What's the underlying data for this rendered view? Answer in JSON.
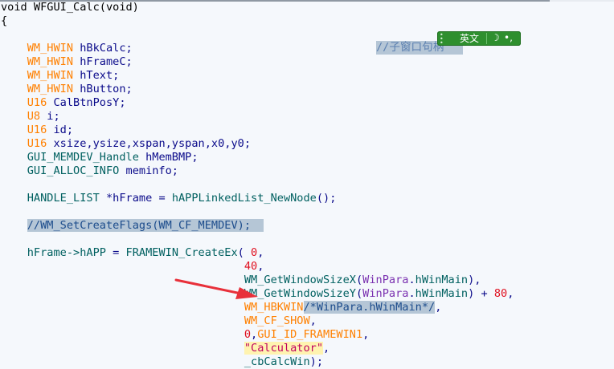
{
  "editor": {
    "lines": [
      [
        {
          "text": "void WFGUI_Calc(void)",
          "cls": "n"
        }
      ],
      [
        {
          "text": "{",
          "cls": "n"
        }
      ],
      [],
      [
        {
          "text": "    "
        },
        {
          "text": "WM_HWIN",
          "cls": "t"
        },
        {
          "text": " hBkCalc;",
          "cls": "v"
        }
      ],
      [
        {
          "text": "    "
        },
        {
          "text": "WM_HWIN",
          "cls": "t"
        },
        {
          "text": " hFrameC;",
          "cls": "v"
        }
      ],
      [
        {
          "text": "    "
        },
        {
          "text": "WM_HWIN",
          "cls": "t"
        },
        {
          "text": " hText;",
          "cls": "v"
        }
      ],
      [
        {
          "text": "    "
        },
        {
          "text": "WM_HWIN",
          "cls": "t"
        },
        {
          "text": " hButton;",
          "cls": "v"
        }
      ],
      [
        {
          "text": "    "
        },
        {
          "text": "U16",
          "cls": "t"
        },
        {
          "text": " CalBtnPosY;",
          "cls": "v"
        }
      ],
      [
        {
          "text": "    "
        },
        {
          "text": "U8",
          "cls": "t"
        },
        {
          "text": " i;",
          "cls": "v"
        }
      ],
      [
        {
          "text": "    "
        },
        {
          "text": "U16",
          "cls": "t"
        },
        {
          "text": " id;",
          "cls": "v"
        }
      ],
      [
        {
          "text": "    "
        },
        {
          "text": "U16",
          "cls": "t"
        },
        {
          "text": " xsize,ysize,xspan,yspan,x0,y0;",
          "cls": "v"
        }
      ],
      [
        {
          "text": "    "
        },
        {
          "text": "GUI_MEMDEV_Handle",
          "cls": "f"
        },
        {
          "text": " hMemBMP;",
          "cls": "v"
        }
      ],
      [
        {
          "text": "    "
        },
        {
          "text": "GUI_ALLOC_INFO",
          "cls": "f"
        },
        {
          "text": " meminfo;",
          "cls": "v"
        }
      ],
      [],
      [
        {
          "text": "    "
        },
        {
          "text": "HANDLE_LIST",
          "cls": "f"
        },
        {
          "text": " *hFrame = ",
          "cls": "v"
        },
        {
          "text": "hAPPLinkedList_NewNode",
          "cls": "f"
        },
        {
          "text": "();",
          "cls": "v"
        }
      ],
      [],
      [
        {
          "text": "    "
        },
        {
          "text": "//WM_SetCreateFlags(WM_CF_MEMDEV);  ",
          "cls": "hlc"
        }
      ],
      [],
      [
        {
          "text": "    "
        },
        {
          "text": "hFrame->hAPP",
          "cls": "f"
        },
        {
          "text": " = ",
          "cls": "v"
        },
        {
          "text": "FRAMEWIN_CreateEx",
          "cls": "f"
        },
        {
          "text": "( ",
          "cls": "v"
        },
        {
          "text": "0",
          "cls": "r"
        },
        {
          "text": ",",
          "cls": "v"
        }
      ],
      [
        {
          "text": "                                     "
        },
        {
          "text": "40",
          "cls": "r"
        },
        {
          "text": ",",
          "cls": "v"
        }
      ],
      [
        {
          "text": "                                     "
        },
        {
          "text": "WM_GetWindowSizeX",
          "cls": "f"
        },
        {
          "text": "(",
          "cls": "v"
        },
        {
          "text": "WinPara",
          "cls": "m"
        },
        {
          "text": ".",
          "cls": "v"
        },
        {
          "text": "hWinMain",
          "cls": "f"
        },
        {
          "text": "),",
          "cls": "v"
        }
      ],
      [
        {
          "text": "                                     "
        },
        {
          "text": "WM_GetWindowSizeY",
          "cls": "f"
        },
        {
          "text": "(",
          "cls": "v"
        },
        {
          "text": "WinPara",
          "cls": "m"
        },
        {
          "text": ".",
          "cls": "v"
        },
        {
          "text": "hWinMain",
          "cls": "f"
        },
        {
          "text": ") + ",
          "cls": "v"
        },
        {
          "text": "80",
          "cls": "r"
        },
        {
          "text": ",",
          "cls": "v"
        }
      ],
      [
        {
          "text": "                                     "
        },
        {
          "text": "WM_HBKWIN",
          "cls": "t"
        },
        {
          "text": "/*WinPara.hWinMain*/",
          "cls": "hlc"
        },
        {
          "text": ",",
          "cls": "v"
        }
      ],
      [
        {
          "text": "                                     "
        },
        {
          "text": "WM_CF_SHOW",
          "cls": "t"
        },
        {
          "text": ",",
          "cls": "v"
        }
      ],
      [
        {
          "text": "                                     "
        },
        {
          "text": "0",
          "cls": "r"
        },
        {
          "text": ",",
          "cls": "v"
        },
        {
          "text": "GUI_ID_FRAMEWIN1",
          "cls": "t"
        },
        {
          "text": ",",
          "cls": "v"
        }
      ],
      [
        {
          "text": "                                     "
        },
        {
          "text": "\"Calculator\"",
          "cls": "str"
        },
        {
          "text": ",",
          "cls": "v"
        }
      ],
      [
        {
          "text": "                                     "
        },
        {
          "text": "_cbCalcWin",
          "cls": "f"
        },
        {
          "text": ");",
          "cls": "v"
        }
      ]
    ],
    "floating_comment": "//子窗口句柄"
  },
  "ime_toolbar": {
    "language_label": "英文",
    "mode_icon": "moon-icon",
    "punct_label": "•,",
    "color": "#2e8f2e"
  },
  "annotation": {
    "arrow_color": "#e8303a",
    "icon": "red-arrow-icon"
  }
}
